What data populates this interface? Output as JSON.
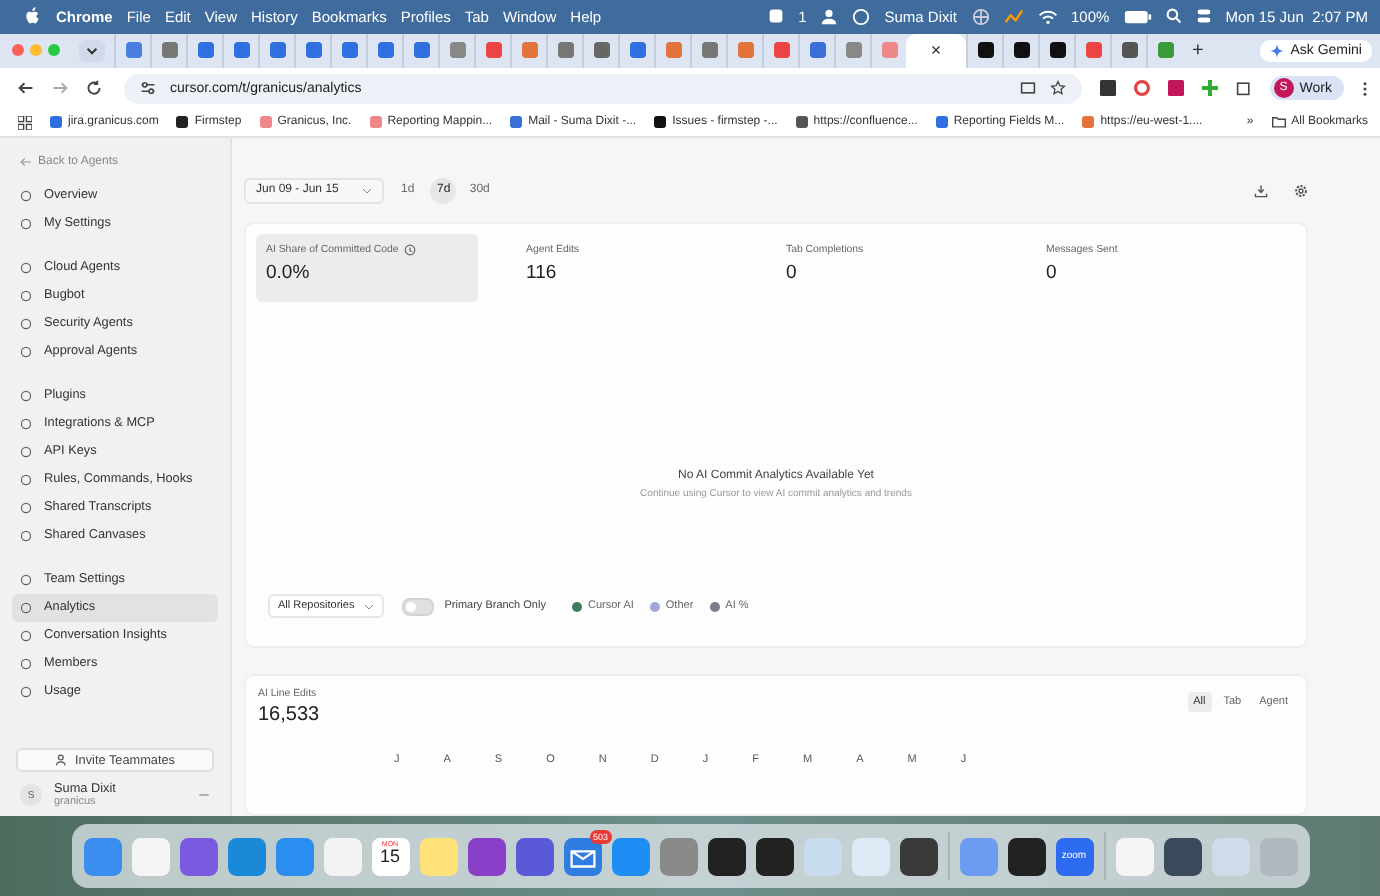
{
  "menu_bar": {
    "app": "Chrome",
    "menus": [
      "File",
      "Edit",
      "View",
      "History",
      "Bookmarks",
      "Profiles",
      "Tab",
      "Window",
      "Help"
    ],
    "notification_count": "1",
    "user": "Suma Dixit",
    "battery": "100%",
    "datetime": "Mon 15 Jun  2:07 PM"
  },
  "browser": {
    "tabs": [
      {
        "selected": false
      },
      {
        "selected": false
      },
      {
        "selected": false
      },
      {
        "selected": false
      },
      {
        "selected": false
      },
      {
        "selected": false
      },
      {
        "selected": false
      },
      {
        "selected": false
      },
      {
        "selected": false
      },
      {
        "selected": false
      },
      {
        "selected": false
      },
      {
        "selected": false
      },
      {
        "selected": false
      },
      {
        "selected": false
      },
      {
        "selected": false
      },
      {
        "selected": false
      },
      {
        "selected": false
      },
      {
        "selected": false
      },
      {
        "selected": false
      },
      {
        "selected": false
      },
      {
        "selected": false
      },
      {
        "selected": false
      },
      {
        "selected": true
      },
      {
        "selected": false
      },
      {
        "selected": false
      },
      {
        "selected": false
      },
      {
        "selected": false
      },
      {
        "selected": false
      },
      {
        "selected": false
      }
    ],
    "close_tab": "×",
    "new_tab": "+",
    "ask_button": "Ask Gemini",
    "url": "cursor.com/t/granicus/analytics",
    "profile_initial": "S",
    "profile": "Work",
    "bookmarks": [
      "jira.granicus.com",
      "Firmstep",
      "Granicus, Inc.",
      "Reporting Mappin...",
      "Mail - Suma Dixit -...",
      "Issues - firmstep -...",
      "https://confluence...",
      "Reporting Fields M...",
      "https://eu-west-1...."
    ],
    "more_bookmarks": "»",
    "all_bookmarks": "All Bookmarks"
  },
  "sidebar": {
    "back": "Back to Agents",
    "groups": [
      {
        "items": [
          {
            "label": "Overview",
            "selected": false
          },
          {
            "label": "My Settings",
            "selected": false
          }
        ]
      },
      {
        "items": [
          {
            "label": "Cloud Agents",
            "selected": false
          },
          {
            "label": "Bugbot",
            "selected": false
          },
          {
            "label": "Security Agents",
            "selected": false
          },
          {
            "label": "Approval Agents",
            "selected": false
          }
        ]
      },
      {
        "items": [
          {
            "label": "Plugins",
            "selected": false
          },
          {
            "label": "Integrations & MCP",
            "selected": false
          },
          {
            "label": "API Keys",
            "selected": false
          },
          {
            "label": "Rules, Commands, Hooks",
            "selected": false
          },
          {
            "label": "Shared Transcripts",
            "selected": false
          },
          {
            "label": "Shared Canvases",
            "selected": false
          }
        ]
      },
      {
        "items": [
          {
            "label": "Team Settings",
            "selected": false
          },
          {
            "label": "Analytics",
            "selected": true
          },
          {
            "label": "Conversation Insights",
            "selected": false
          },
          {
            "label": "Members",
            "selected": false
          },
          {
            "label": "Usage",
            "selected": false
          }
        ]
      }
    ],
    "invite_button": "Invite Teammates",
    "user": {
      "initial": "S",
      "name": "Suma Dixit",
      "team": "granicus"
    }
  },
  "toolbar": {
    "date_range": "Jun 09 - Jun 15",
    "ranges": [
      {
        "label": "1d",
        "selected": false
      },
      {
        "label": "7d",
        "selected": true
      },
      {
        "label": "30d",
        "selected": false
      }
    ]
  },
  "stats": [
    {
      "label": "AI Share of Committed Code",
      "value": "0.0%",
      "selected": true,
      "info": true
    },
    {
      "label": "Agent Edits",
      "value": "116",
      "selected": false,
      "info": false
    },
    {
      "label": "Tab Completions",
      "value": "0",
      "selected": false,
      "info": false
    },
    {
      "label": "Messages Sent",
      "value": "0",
      "selected": false,
      "info": false
    }
  ],
  "empty_state": {
    "title": "No AI Commit Analytics Available Yet",
    "subtitle": "Continue using Cursor to view AI commit analytics and trends"
  },
  "filters": {
    "repository": "All Repositories",
    "primary_branch_toggle": {
      "label": "Primary Branch Only",
      "on": false
    },
    "legend": [
      {
        "label": "Cursor AI",
        "color": "#3f7d5a"
      },
      {
        "label": "Other",
        "color": "#9ea8dc"
      },
      {
        "label": "AI %",
        "color": "#7c7c88"
      }
    ]
  },
  "line_edits": {
    "label": "AI Line Edits",
    "value": "16,533",
    "tabs": [
      {
        "label": "All",
        "selected": true
      },
      {
        "label": "Tab",
        "selected": false
      },
      {
        "label": "Agent",
        "selected": false
      }
    ],
    "month_labels": [
      "J",
      "A",
      "S",
      "O",
      "N",
      "D",
      "J",
      "F",
      "M",
      "A",
      "M",
      "J"
    ]
  },
  "dock": {
    "calendar_month": "MON",
    "calendar_day": "15",
    "mail_badge": "503",
    "zoom_label": "zoom"
  }
}
